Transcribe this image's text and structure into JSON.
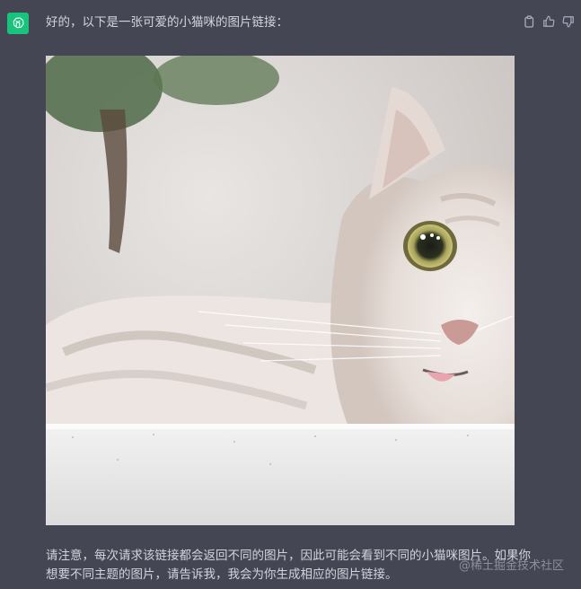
{
  "message": {
    "intro": "好的，以下是一张可爱的小猫咪的图片链接：",
    "image_alt": "小猫咪",
    "paragraph_line1": "请注意，每次请求该链接都会返回不同的图片，因此可能会看到不同的小猫咪图片。如果你",
    "paragraph_line2": "想要不同主题的图片，请告诉我，我会为你生成相应的图片链接。"
  },
  "watermark": "@稀土掘金技术社区",
  "icons": {
    "avatar": "openai-logo-icon",
    "actions": [
      "copy-icon",
      "thumbs-up-icon",
      "thumbs-down-icon"
    ]
  },
  "colors": {
    "background": "#444654",
    "avatar": "#19c37d",
    "text": "#d1d5db",
    "icon": "#acacbe"
  }
}
